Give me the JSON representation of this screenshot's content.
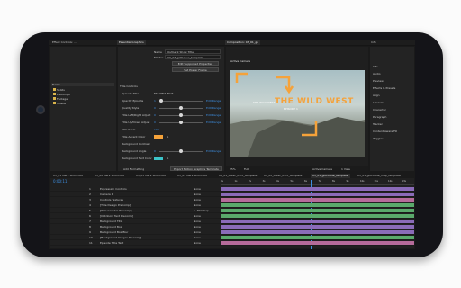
{
  "colors": {
    "accent": "#f5a23a",
    "blue": "#3d8ee0",
    "purple": "#8a6bb8",
    "green": "#5aa96b",
    "teal": "#3cc4c9",
    "pink": "#b56b9a"
  },
  "tabs": {
    "project": "Effect Controls: ...",
    "essential": "Essential Graphics",
    "composition": "Composition: 03_01_go",
    "info": "Info"
  },
  "effect_panel": {
    "title_field_label": "Name",
    "title_value": "Outback Show Title",
    "master_label": "Master",
    "master_value": "03_03_gothouse_template",
    "buttons": [
      "Edit Supported Properties",
      "Set Poster Frame"
    ],
    "section_label": "Title Controls",
    "properties": [
      {
        "label": "Episode Title",
        "value": "The Wild West"
      },
      {
        "label": "Opacity Episode",
        "value": "1"
      },
      {
        "label": "Quality Style",
        "value": "0"
      },
      {
        "label": "Title Left/Right Adjust",
        "value": "0"
      },
      {
        "label": "Title Up/Down Adjust",
        "value": "0"
      },
      {
        "label": "Title Scale",
        "value": "100"
      },
      {
        "label": "Title Accent Color",
        "value": ""
      },
      {
        "label": "Background Contrast",
        "value": ""
      },
      {
        "label": "Background Angle",
        "value": "0"
      },
      {
        "label": "Background Text Color",
        "value": ""
      }
    ],
    "edit_links": [
      "Edit Range",
      "Edit Range",
      "Edit Range",
      "Edit Range",
      "Edit Range"
    ],
    "add_formatting": "Add Formatting",
    "export_btn": "Export Motion Graphics Template"
  },
  "left_panel": {
    "items": [
      "Name",
      "Solids",
      "Precomps",
      "Footage",
      "Videos"
    ]
  },
  "viewer": {
    "title_text": "THE WILD WEST",
    "sub_text": "EPISODE 1",
    "left_label": "THE WILD WEST",
    "zoom": "25%",
    "resolution": "Full",
    "camera": "Active Camera",
    "views": "1 View"
  },
  "right_panel": {
    "items": [
      "Info",
      "Audio",
      "Preview",
      "Effects & Presets",
      "Align",
      "Libraries",
      "Character",
      "Paragraph",
      "Tracker",
      "Content-Aware Fill",
      "Wiggler"
    ]
  },
  "timeline": {
    "tabs": [
      "03_01 Mark Shortcuts",
      "03_02 Mark Shortcuts",
      "03_03 Mark Shortcuts",
      "03_03 Mark Shortcuts",
      "04_01_lower_third_template",
      "04_02_lower_third_template",
      "05_01_gothouse_template",
      "05_01_gothouse_map_template"
    ],
    "timecode": "0:00:11",
    "layers": [
      {
        "num": "1",
        "name": "Expression Controls"
      },
      {
        "num": "2",
        "name": "Camera 1"
      },
      {
        "num": "3",
        "name": "Controls Textures"
      },
      {
        "num": "4",
        "name": "[Title Design Precomp]"
      },
      {
        "num": "5",
        "name": "[Title Graphic Precomp]"
      },
      {
        "num": "6",
        "name": "[Outdoors Text Precomp]"
      },
      {
        "num": "7",
        "name": "Background Title"
      },
      {
        "num": "8",
        "name": "Background Box"
      },
      {
        "num": "9",
        "name": "Background Box Blur"
      },
      {
        "num": "10",
        "name": "[Background Images Precomp]"
      },
      {
        "num": "11",
        "name": "Episode Title Text"
      }
    ],
    "modes": [
      "None",
      "None",
      "None",
      "None",
      "1. Title/Grp",
      "None",
      "None",
      "None",
      "None",
      "None",
      "None"
    ],
    "ruler_ticks": [
      "0s",
      "1s",
      "2s",
      "3s",
      "4s",
      "5s",
      "6s",
      "7s",
      "8s",
      "9s",
      "10s",
      "11s",
      "12s",
      "13s"
    ]
  }
}
